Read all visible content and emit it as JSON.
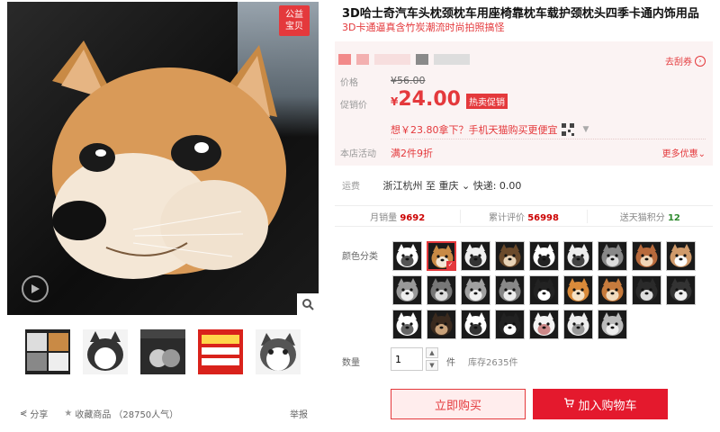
{
  "gallery": {
    "badge_line1": "公益",
    "badge_line2": "宝贝",
    "thumbnail_count": 5
  },
  "product": {
    "title": "3D哈士奇汽车头枕颈枕车用座椅靠枕车载护颈枕头四季卡通内饰用品",
    "subtitle": "3D卡通逼真含竹炭潮流时尚拍照搞怪"
  },
  "price_box": {
    "coupon_label": "去刮券",
    "price_label": "价格",
    "original_price": "¥56.00",
    "promo_label": "促销价",
    "currency": "¥",
    "promo_price": "24.00",
    "hot_tag": "热卖促销",
    "app_tip": "想￥23.80拿下？手机天猫购买更便宜",
    "store_activity_label": "本店活动",
    "store_activity": "满2件9折",
    "more_promos": "更多优惠"
  },
  "shipping": {
    "label": "运费",
    "text": "浙江杭州 至 重庆",
    "express": "快递: 0.00"
  },
  "stats": {
    "monthly_sales_label": "月销量",
    "monthly_sales": "9692",
    "reviews_label": "累计评价",
    "reviews": "56998",
    "points_label": "送天猫积分",
    "points": "12"
  },
  "sku": {
    "color_label": "颜色分类",
    "swatch_count": 25,
    "selected_index": 1
  },
  "quantity": {
    "label": "数量",
    "value": "1",
    "unit": "件",
    "stock": "库存2635件"
  },
  "actions": {
    "buy_now": "立即购买",
    "add_cart": "加入购物车"
  },
  "footer": {
    "share": "分享",
    "favorite": "收藏商品",
    "popularity": "（28750人气）",
    "report": "举报"
  },
  "colors": {
    "accent": "#e4393c",
    "cart_button": "#e4192d",
    "price_box_bg": "#fbf3f3"
  }
}
